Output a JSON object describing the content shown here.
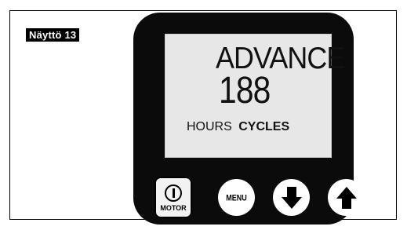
{
  "label": "Näyttö 13",
  "display": {
    "mode": "ADVANCE",
    "value": "188",
    "unit_hours": "HOURS",
    "unit_cycles": "CYCLES"
  },
  "buttons": {
    "motor_label": "MOTOR",
    "menu_label": "MENU",
    "down_icon": "arrow-down-icon",
    "up_icon": "arrow-up-icon"
  }
}
